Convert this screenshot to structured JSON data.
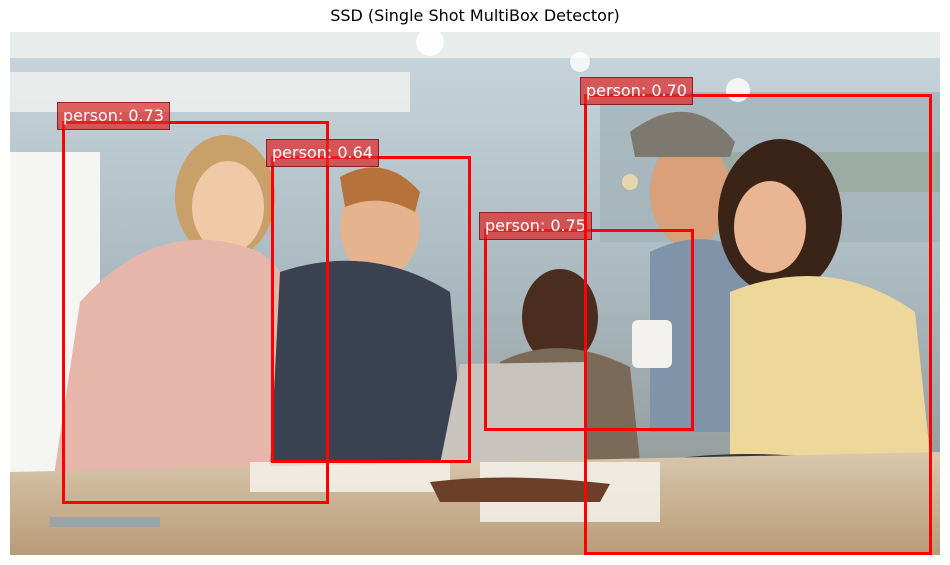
{
  "figure": {
    "title": "SSD (Single Shot MultiBox Detector)"
  },
  "photo": {
    "description_icon": "office-team-laptop-photo"
  },
  "detections": [
    {
      "class": "person",
      "score": "0.73",
      "text": "person: 0.73"
    },
    {
      "class": "person",
      "score": "0.64",
      "text": "person: 0.64"
    },
    {
      "class": "person",
      "score": "0.75",
      "text": "person: 0.75"
    },
    {
      "class": "person",
      "score": "0.70",
      "text": "person: 0.70"
    }
  ],
  "colors": {
    "box": "#ff0000",
    "label_bg": "#dc2828"
  }
}
